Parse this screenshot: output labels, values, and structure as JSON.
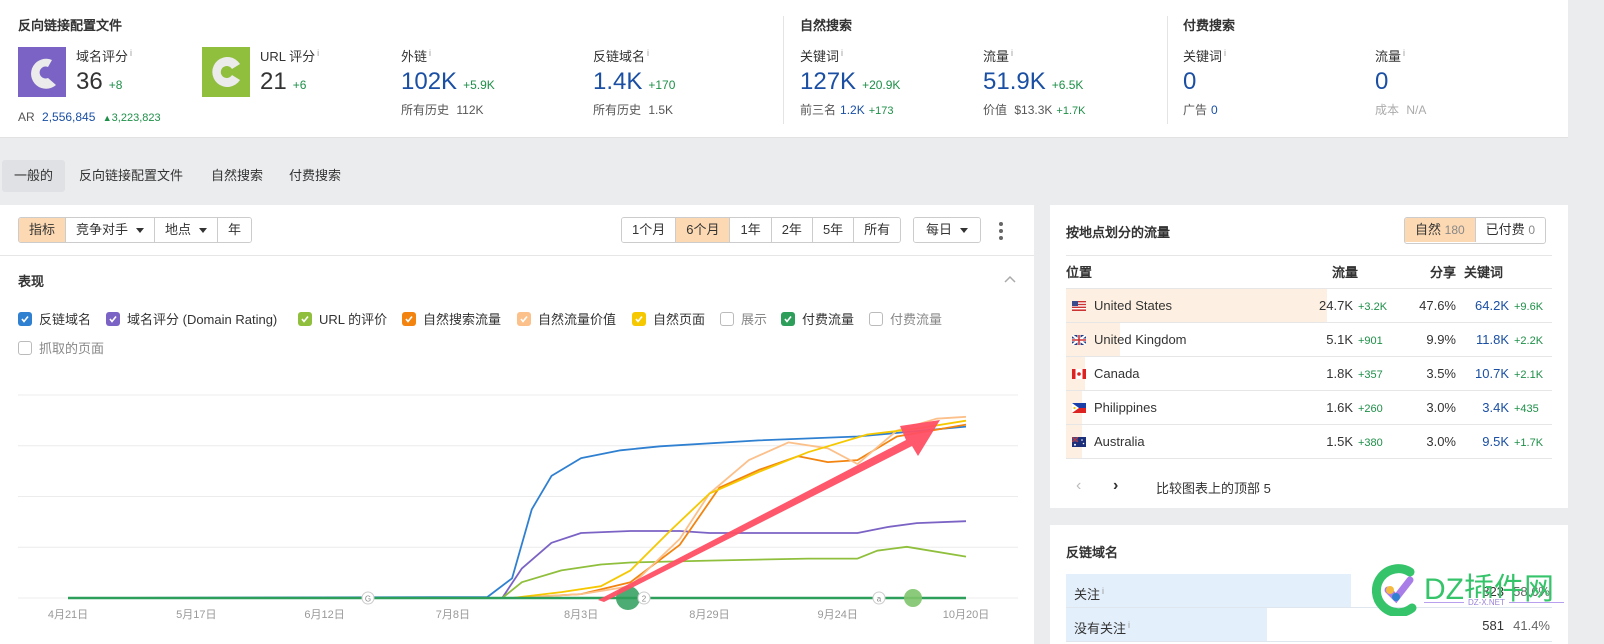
{
  "header": {
    "backlink_profile": {
      "title": "反向链接配置文件",
      "domain_rating": {
        "label": "域名评分",
        "value": "36",
        "delta": "+8",
        "ar_label": "AR",
        "ar_value": "2,556,845",
        "ar_delta": "3,223,823",
        "color": "#7b63c5"
      },
      "url_rating": {
        "label": "URL 评分",
        "value": "21",
        "delta": "+6",
        "color": "#8fbf3c"
      },
      "backlinks": {
        "label": "外链",
        "value": "102K",
        "delta": "+5.9K",
        "sub_label": "所有历史",
        "sub_value": "112K"
      },
      "ref_domains": {
        "label": "反链域名",
        "value": "1.4K",
        "delta": "+170",
        "sub_label": "所有历史",
        "sub_value": "1.5K"
      }
    },
    "organic": {
      "title": "自然搜索",
      "keywords": {
        "label": "关键词",
        "value": "127K",
        "delta": "+20.9K",
        "sub_label": "前三名",
        "sub_value": "1.2K",
        "sub_delta": "+173"
      },
      "traffic": {
        "label": "流量",
        "value": "51.9K",
        "delta": "+6.5K",
        "sub_label": "价值",
        "sub_value": "$13.3K",
        "sub_delta": "+1.7K"
      }
    },
    "paid": {
      "title": "付费搜索",
      "keywords": {
        "label": "关键词",
        "value": "0",
        "sub_label": "广告",
        "sub_value": "0"
      },
      "traffic": {
        "label": "流量",
        "value": "0",
        "sub_label": "成本",
        "sub_value": "N/A"
      }
    },
    "info_glyph": "i"
  },
  "tabs": [
    {
      "label": "一般的",
      "active": true
    },
    {
      "label": "反向链接配置文件"
    },
    {
      "label": "自然搜索"
    },
    {
      "label": "付费搜索"
    }
  ],
  "toolbar": {
    "left": [
      {
        "label": "指标",
        "selected": true
      },
      {
        "label": "竞争对手",
        "dropdown": true
      },
      {
        "label": "地点",
        "dropdown": true
      },
      {
        "label": "年"
      }
    ],
    "ranges": [
      {
        "label": "1个月"
      },
      {
        "label": "6个月",
        "selected": true
      },
      {
        "label": "1年"
      },
      {
        "label": "2年"
      },
      {
        "label": "5年"
      },
      {
        "label": "所有"
      }
    ],
    "interval": "每日"
  },
  "performance": {
    "title": "表现",
    "legend": [
      {
        "label": "反链域名",
        "checked": true,
        "color": "#2f80d1"
      },
      {
        "label": "域名评分 (Domain Rating)",
        "checked": true,
        "color": "#7b63c5"
      },
      {
        "label": "URL 的评价",
        "checked": true,
        "color": "#8fbf3c"
      },
      {
        "label": "自然搜索流量",
        "checked": true,
        "color": "#f2840f"
      },
      {
        "label": "自然流量价值",
        "checked": true,
        "color": "#fcc08a"
      },
      {
        "label": "自然页面",
        "checked": true,
        "color": "#f5c800"
      },
      {
        "label": "展示",
        "checked": false
      },
      {
        "label": "付费流量",
        "checked": true,
        "color": "#2e9e5b"
      },
      {
        "label": "付费流量",
        "checked": false
      },
      {
        "label": "抓取的页面",
        "checked": false
      }
    ],
    "markers": [
      "G",
      "2",
      "a"
    ]
  },
  "chart_data": {
    "type": "line",
    "title": "表现",
    "x_ticks": [
      "4月21日",
      "5月17日",
      "6月12日",
      "7月8日",
      "8月3日",
      "8月29日",
      "9月24日",
      "10月20日"
    ],
    "x_range": [
      "4月21日",
      "10月20日"
    ],
    "y_range": [
      0,
      100
    ],
    "y_unit": "relative (normalized, no axis labels)",
    "grid": true,
    "x_index_range": [
      0,
      182
    ],
    "series": [
      {
        "name": "反链域名",
        "color": "#2f80d1",
        "points": [
          [
            0,
            0
          ],
          [
            85,
            0.5
          ],
          [
            90,
            10
          ],
          [
            94,
            45
          ],
          [
            98,
            62
          ],
          [
            104,
            71
          ],
          [
            112,
            75
          ],
          [
            120,
            77
          ],
          [
            140,
            80
          ],
          [
            160,
            82
          ],
          [
            182,
            87
          ]
        ]
      },
      {
        "name": "域名评分 (Domain Rating)",
        "color": "#7b63c5",
        "points": [
          [
            0,
            0
          ],
          [
            88,
            0
          ],
          [
            92,
            15
          ],
          [
            98,
            28
          ],
          [
            104,
            33
          ],
          [
            114,
            34
          ],
          [
            124,
            34
          ],
          [
            130,
            33
          ],
          [
            160,
            33
          ],
          [
            166,
            36
          ],
          [
            172,
            38
          ],
          [
            182,
            39
          ]
        ]
      },
      {
        "name": "URL 的评价",
        "color": "#8fbf3c",
        "points": [
          [
            0,
            0
          ],
          [
            88,
            0
          ],
          [
            92,
            8
          ],
          [
            100,
            14
          ],
          [
            108,
            17
          ],
          [
            114,
            18
          ],
          [
            130,
            19
          ],
          [
            150,
            20
          ],
          [
            160,
            20
          ],
          [
            164,
            24
          ],
          [
            170,
            26
          ],
          [
            182,
            21
          ]
        ]
      },
      {
        "name": "自然搜索流量",
        "color": "#f2840f",
        "points": [
          [
            0,
            0
          ],
          [
            90,
            0
          ],
          [
            104,
            2
          ],
          [
            114,
            8
          ],
          [
            124,
            27
          ],
          [
            132,
            56
          ],
          [
            140,
            65
          ],
          [
            148,
            72
          ],
          [
            154,
            69
          ],
          [
            160,
            70
          ],
          [
            168,
            82
          ],
          [
            182,
            88
          ]
        ]
      },
      {
        "name": "自然流量价值",
        "color": "#fcc08a",
        "points": [
          [
            0,
            0
          ],
          [
            90,
            0
          ],
          [
            104,
            2
          ],
          [
            114,
            6
          ],
          [
            124,
            30
          ],
          [
            130,
            53
          ],
          [
            138,
            70
          ],
          [
            146,
            79
          ],
          [
            154,
            76
          ],
          [
            160,
            68
          ],
          [
            168,
            85
          ],
          [
            176,
            91
          ],
          [
            182,
            92
          ]
        ]
      },
      {
        "name": "自然页面",
        "color": "#f5c800",
        "points": [
          [
            0,
            0
          ],
          [
            90,
            0
          ],
          [
            100,
            3
          ],
          [
            108,
            6
          ],
          [
            114,
            14
          ],
          [
            122,
            34
          ],
          [
            130,
            53
          ],
          [
            140,
            64
          ],
          [
            150,
            74
          ],
          [
            162,
            83
          ],
          [
            172,
            86
          ],
          [
            182,
            90
          ]
        ]
      },
      {
        "name": "付费流量",
        "color": "#2e9e5b",
        "points": [
          [
            0,
            0
          ],
          [
            182,
            0
          ]
        ]
      }
    ],
    "annotation": "red arrow pointing upward to the right"
  },
  "geo": {
    "title": "按地点划分的流量",
    "toggle": [
      {
        "label": "自然",
        "count": "180",
        "selected": true
      },
      {
        "label": "已付费",
        "count": "0"
      }
    ],
    "columns": [
      "位置",
      "流量",
      "分享",
      "关键词"
    ],
    "rows": [
      {
        "country": "United States",
        "flag": "us",
        "traffic": "24.7K",
        "traffic_delta": "+3.2K",
        "share": "47.6%",
        "share_value": 47.6,
        "keywords": "64.2K",
        "kw_delta": "+9.6K"
      },
      {
        "country": "United Kingdom",
        "flag": "gb",
        "traffic": "5.1K",
        "traffic_delta": "+901",
        "share": "9.9%",
        "share_value": 9.9,
        "keywords": "11.8K",
        "kw_delta": "+2.2K"
      },
      {
        "country": "Canada",
        "flag": "ca",
        "traffic": "1.8K",
        "traffic_delta": "+357",
        "share": "3.5%",
        "share_value": 3.5,
        "keywords": "10.7K",
        "kw_delta": "+2.1K"
      },
      {
        "country": "Philippines",
        "flag": "ph",
        "traffic": "1.6K",
        "traffic_delta": "+260",
        "share": "3.0%",
        "share_value": 3.0,
        "keywords": "3.4K",
        "kw_delta": "+435"
      },
      {
        "country": "Australia",
        "flag": "au",
        "traffic": "1.5K",
        "traffic_delta": "+380",
        "share": "3.0%",
        "share_value": 3.0,
        "keywords": "9.5K",
        "kw_delta": "+1.7K"
      }
    ],
    "footer": "比较图表上的顶部 5"
  },
  "refdomains": {
    "title": "反链域名",
    "rows": [
      {
        "label": "关注",
        "value": "823",
        "pct": "58.6%",
        "share": 58.6
      },
      {
        "label": "没有关注",
        "value": "581",
        "pct": "41.4%",
        "share": 41.4
      }
    ]
  },
  "watermark": {
    "text": "DZ插件网",
    "sub": "DZ-X.NET"
  }
}
